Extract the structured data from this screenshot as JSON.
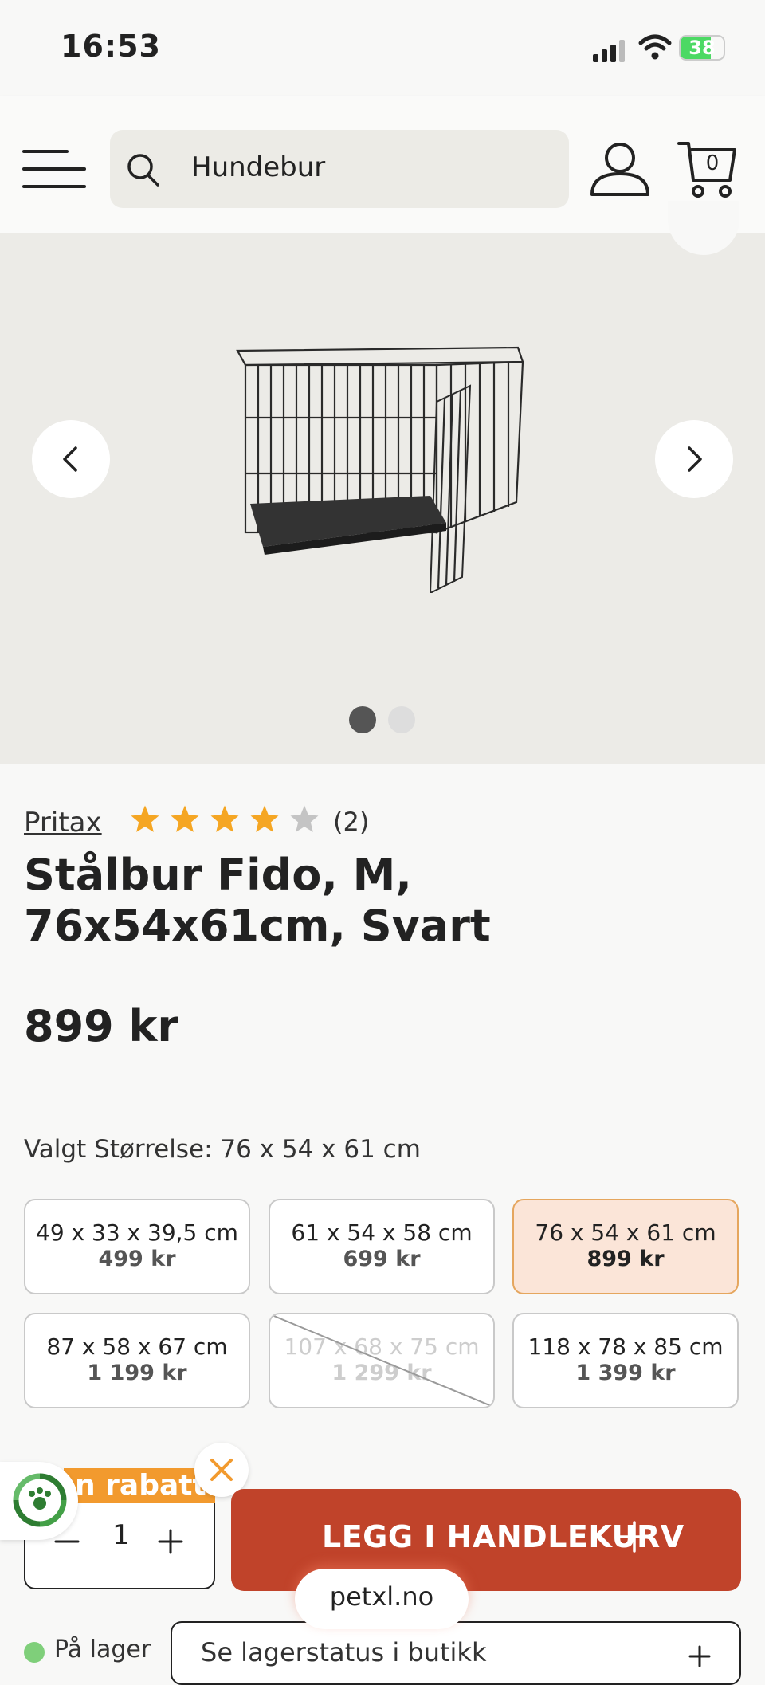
{
  "status_bar": {
    "time": "16:53",
    "battery": "38"
  },
  "header": {
    "search_value": "Hundebur",
    "cart_count": "0"
  },
  "gallery": {
    "image_count": 2,
    "active_index": 0
  },
  "product": {
    "brand": "Pritax",
    "rating": 4,
    "rating_max": 5,
    "review_count": "(2)",
    "title": "Stålbur Fido, M, 76x54x61cm, Svart",
    "price": "899 kr",
    "size_label": "Valgt Størrelse: 76 x 54 x 61 cm"
  },
  "sizes": [
    {
      "size": "49 x 33 x 39,5 cm",
      "price": "499 kr",
      "state": "available"
    },
    {
      "size": "61 x 54 x 58 cm",
      "price": "699 kr",
      "state": "available"
    },
    {
      "size": "76 x 54 x 61 cm",
      "price": "899 kr",
      "state": "selected"
    },
    {
      "size": "87 x 58 x 67 cm",
      "price": "1 199 kr",
      "state": "available"
    },
    {
      "size": "107 x 68 x 75 cm",
      "price": "1 299 kr",
      "state": "unavailable"
    },
    {
      "size": "118 x 78 x 85 cm",
      "price": "1 399 kr",
      "state": "available"
    }
  ],
  "promo": {
    "label": "n rabatt"
  },
  "purchase": {
    "quantity": "1",
    "add_to_cart_label": "LEGG I HANDLEKURV"
  },
  "browser": {
    "domain": "petxl.no"
  },
  "stock": {
    "online_label": "På lager",
    "store_button_label": "Se lagerstatus i butikk"
  },
  "colors": {
    "accent": "#c0432a",
    "star": "#f5a623",
    "selected_bg": "#fbe5d8",
    "promo": "#f29a2e"
  }
}
